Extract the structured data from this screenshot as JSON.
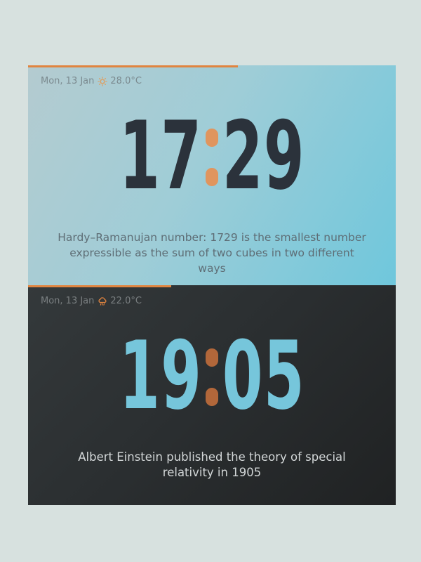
{
  "cards": [
    {
      "theme": "light",
      "date": "Mon, 13 Jan",
      "weather_icon": "sun-icon",
      "temperature": "28.0°C",
      "hours": "17",
      "minutes": "29",
      "progress_percent": 57,
      "fact": "Hardy–Ramanujan number: 1729 is the smallest number expressible as the sum of two cubes in two different ways",
      "accent_color": "#e1843f",
      "digit_color": "#2b323b"
    },
    {
      "theme": "dark",
      "date": "Mon, 13 Jan",
      "weather_icon": "rain-cloud-icon",
      "temperature": "22.0°C",
      "hours": "19",
      "minutes": "05",
      "progress_percent": 39,
      "fact": "Albert Einstein published the theory of special relativity in 1905",
      "accent_color": "#e1843f",
      "digit_color": "#76c6db"
    }
  ]
}
